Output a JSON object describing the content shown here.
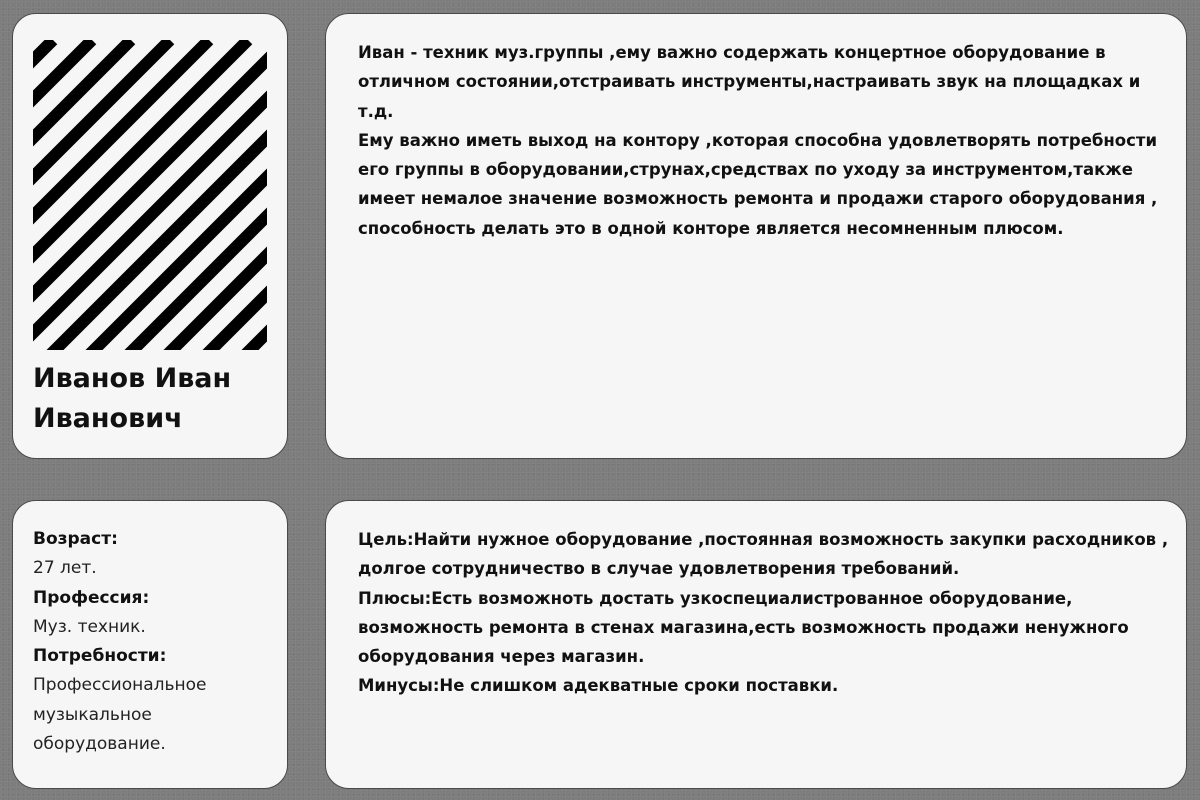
{
  "profile": {
    "name": "Иванов Иван Иванович",
    "photo_icon": "photo-placeholder-icon"
  },
  "story": {
    "paragraphs": [
      "Иван - техник муз.группы ,ему важно содержать концертное оборудование в отличном состоянии,отстраивать инструменты,настраивать звук на площадках и т.д.",
      "Ему важно иметь выход на контору ,которая способна удовлетворять потребности его группы в оборудовании,струнах,средствах по уходу за инструментом,также имеет немалое значение возможность ремонта и продажи старого оборудования , способность делать это в одной конторе является несомненным плюсом."
    ]
  },
  "info": {
    "age_label": "Возраст:",
    "age_value": "27 лет.",
    "profession_label": "Профессия:",
    "profession_value": "Муз. техник.",
    "needs_label": "Потребности:",
    "needs_value": "Профессиональное музыкальное оборудование."
  },
  "goals": {
    "goal": "Цель:Найти нужное оборудование ,постоянная возможность закупки расходников , долгое сотрудничество в случае удовлетворения требований.",
    "pros": "Плюсы:Есть возможноть достать узкоспециалистрованное оборудование, возможность ремонта в стенах магазина,есть возможность продажи ненужного оборудования через магазин.",
    "cons": "Минусы:Не слишком адекватные сроки поставки."
  },
  "colors": {
    "page_background": "#7d7d7d",
    "card_background": "#f6f6f6",
    "card_border": "#4a4a4a",
    "text": "#111111",
    "stripe": "#000000"
  }
}
